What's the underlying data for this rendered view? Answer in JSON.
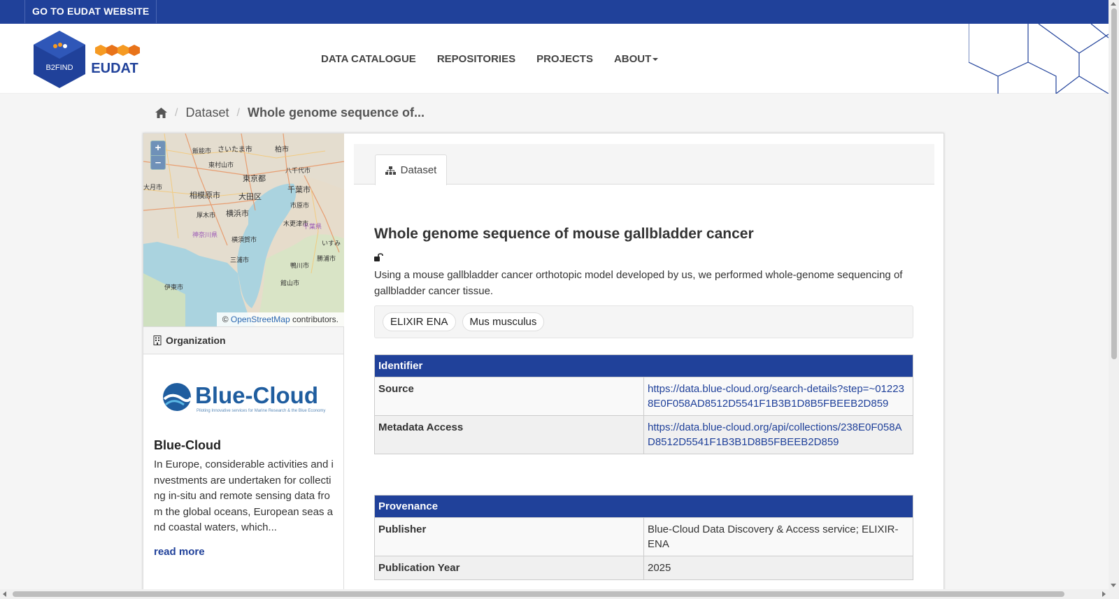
{
  "topbar": {
    "eudat_link": "GO TO EUDAT WEBSITE"
  },
  "logos": {
    "b2find_text": "B2FIND",
    "eudat_text": "EUDAT"
  },
  "nav": {
    "items": [
      {
        "label": "DATA CATALOGUE"
      },
      {
        "label": "REPOSITORIES"
      },
      {
        "label": "PROJECTS"
      },
      {
        "label": "ABOUT",
        "has_caret": true
      }
    ]
  },
  "breadcrumb": {
    "home_icon": "home-icon",
    "dataset": "Dataset",
    "current": "Whole genome sequence of..."
  },
  "map": {
    "zoom_in": "+",
    "zoom_out": "–",
    "attribution_prefix": "©",
    "attribution_link": "OpenStreetMap",
    "attribution_suffix": "contributors.",
    "labels": [
      "さいたま市",
      "柏市",
      "飯能市",
      "八千代市",
      "東村山市",
      "東京都",
      "大月市",
      "相模原市",
      "大田区",
      "千葉市",
      "横浜市",
      "厚木市",
      "市原市",
      "木更津市",
      "千葉県",
      "神奈川県",
      "横須賀市",
      "三浦市",
      "鴨川市",
      "館山市",
      "伊東市",
      "勝浦市",
      "いすみ"
    ]
  },
  "organization": {
    "header": "Organization",
    "logo_text": "Blue-Cloud",
    "logo_tagline": "Piloting Innovative services for Marine Research & the Blue Economy",
    "title": "Blue-Cloud",
    "description": "In Europe, considerable activities and investments are undertaken for collecting in-situ and remote sensing data from the global oceans, European seas and coastal waters, which...",
    "read_more": "read more"
  },
  "tab": {
    "label": "Dataset"
  },
  "dataset": {
    "title": "Whole genome sequence of mouse gallbladder cancer",
    "description": "Using a mouse gallbladder cancer orthotopic model developed by us, we performed whole-genome sequencing of gallbladder cancer tissue.",
    "tags": [
      "ELIXIR ENA",
      "Mus musculus"
    ]
  },
  "identifier": {
    "header": "Identifier",
    "rows": [
      {
        "key": "Source",
        "value": "https://data.blue-cloud.org/search-details?step=~012238E0F058AD8512D5541F1B3B1D8B5FBEEB2D859"
      },
      {
        "key": "Metadata Access",
        "value": "https://data.blue-cloud.org/api/collections/238E0F058AD8512D5541F1B3B1D8B5FBEEB2D859"
      }
    ]
  },
  "provenance": {
    "header": "Provenance",
    "rows": [
      {
        "key": "Publisher",
        "value": "Blue-Cloud Data Discovery & Access service; ELIXIR-ENA"
      },
      {
        "key": "Publication Year",
        "value": "2025"
      }
    ]
  },
  "colors": {
    "brand_blue": "#20419a",
    "link_blue": "#20419a"
  }
}
